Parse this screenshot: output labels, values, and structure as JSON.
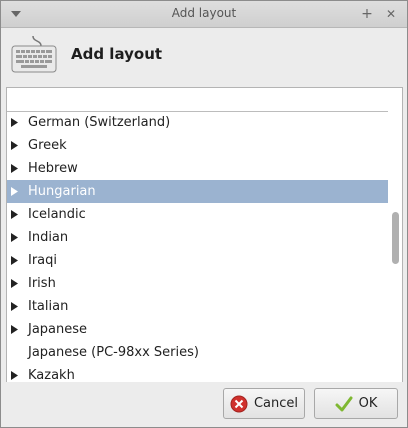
{
  "window": {
    "title": "Add layout",
    "icons": {
      "menu": "chevron-down-icon",
      "maximize": "plus-icon",
      "close": "close-icon"
    },
    "maximize_glyph": "+",
    "close_glyph": "✕"
  },
  "header": {
    "icon": "keyboard-icon",
    "title": "Add layout"
  },
  "layouts": [
    {
      "label": "German (Switzerland)",
      "expandable": true,
      "selected": false
    },
    {
      "label": "Greek",
      "expandable": true,
      "selected": false
    },
    {
      "label": "Hebrew",
      "expandable": true,
      "selected": false
    },
    {
      "label": "Hungarian",
      "expandable": true,
      "selected": true
    },
    {
      "label": "Icelandic",
      "expandable": true,
      "selected": false
    },
    {
      "label": "Indian",
      "expandable": true,
      "selected": false
    },
    {
      "label": "Iraqi",
      "expandable": true,
      "selected": false
    },
    {
      "label": "Irish",
      "expandable": true,
      "selected": false
    },
    {
      "label": "Italian",
      "expandable": true,
      "selected": false
    },
    {
      "label": "Japanese",
      "expandable": true,
      "selected": false
    },
    {
      "label": "Japanese (PC-98xx Series)",
      "expandable": false,
      "selected": false
    },
    {
      "label": "Kazakh",
      "expandable": true,
      "selected": false
    }
  ],
  "buttons": {
    "cancel": {
      "label": "Cancel",
      "icon": "cancel-icon",
      "icon_color": "#d0312d"
    },
    "ok": {
      "label": "OK",
      "icon": "checkmark-icon",
      "icon_color": "#7fb832"
    }
  },
  "colors": {
    "selection": "#9bb3d0",
    "selection_text": "#ffffff"
  }
}
